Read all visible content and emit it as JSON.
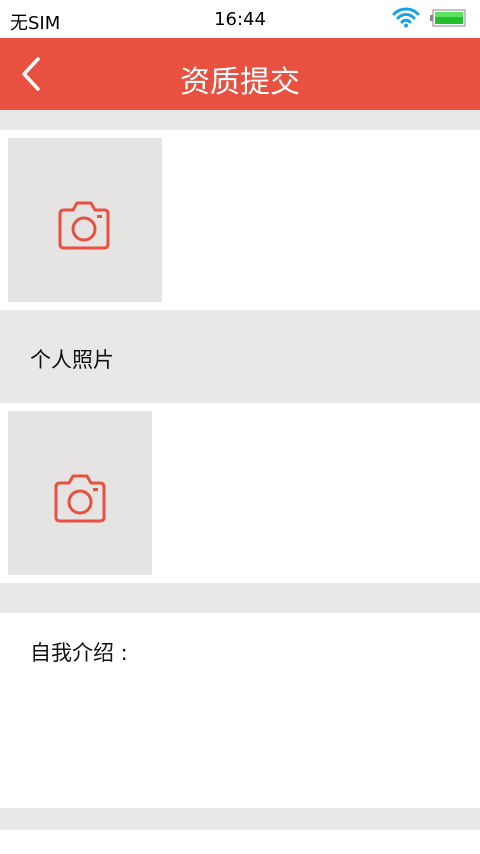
{
  "status": {
    "carrier": "无SIM",
    "time": "16:44",
    "icons": [
      "wifi-icon",
      "battery-icon"
    ]
  },
  "nav": {
    "title": "资质提交",
    "back_icon": "chevron-left-icon"
  },
  "sections": {
    "photo1_icon": "camera-icon",
    "personal_photo_label": "个人照片",
    "photo2_icon": "camera-icon",
    "intro_label": "自我介绍 :",
    "intro_value": ""
  },
  "colors": {
    "accent": "#e85040",
    "background": "#e8e8e8",
    "photo_placeholder": "#e5e4e2"
  }
}
